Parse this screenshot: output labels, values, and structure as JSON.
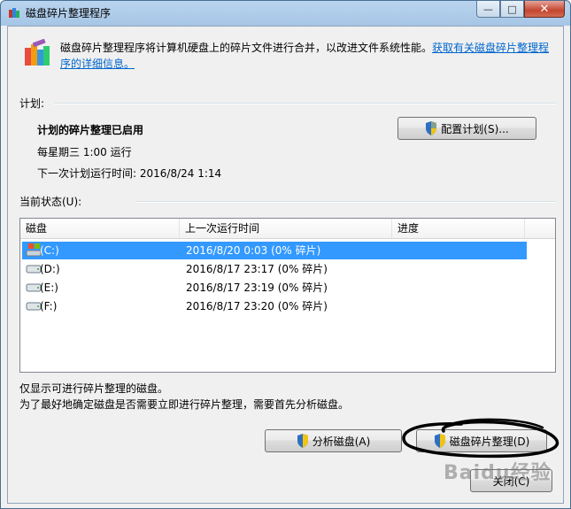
{
  "window": {
    "title": "磁盘碎片整理程序",
    "minimize_glyph": "—",
    "maximize_glyph": "□",
    "close_glyph": "✕"
  },
  "header": {
    "description": "磁盘碎片整理程序将计算机硬盘上的碎片文件进行合并，以改进文件系统性能。",
    "link_text": "获取有关磁盘碎片整理程序的详细信息。"
  },
  "schedule": {
    "group_label": "计划:",
    "status": "计划的碎片整理已启用",
    "frequency": "每星期三  1:00 运行",
    "next_run": "下一次计划运行时间: 2016/8/24 1:14",
    "configure_button": "配置计划(S)..."
  },
  "current_status": {
    "group_label": "当前状态(U):",
    "columns": [
      "磁盘",
      "上一次运行时间",
      "进度"
    ],
    "rows": [
      {
        "disk": "(C:)",
        "last_run": "2016/8/20 0:03 (0% 碎片)",
        "progress": "",
        "selected": true
      },
      {
        "disk": "(D:)",
        "last_run": "2016/8/17 23:17 (0% 碎片)",
        "progress": "",
        "selected": false
      },
      {
        "disk": "(E:)",
        "last_run": "2016/8/17 23:19 (0% 碎片)",
        "progress": "",
        "selected": false
      },
      {
        "disk": "(F:)",
        "last_run": "2016/8/17 23:20 (0% 碎片)",
        "progress": "",
        "selected": false
      }
    ]
  },
  "footer": {
    "note1": "仅显示可进行碎片整理的磁盘。",
    "note2": "为了最好地确定磁盘是否需要立即进行碎片整理，需要首先分析磁盘。",
    "analyze_button": "分析磁盘(A)",
    "defrag_button": "磁盘碎片整理(D)",
    "close_button": "关闭(C)"
  },
  "watermark": "Baidu经验",
  "colors": {
    "selection": "#3399ff",
    "link": "#0066cc",
    "ink": "#000000"
  }
}
